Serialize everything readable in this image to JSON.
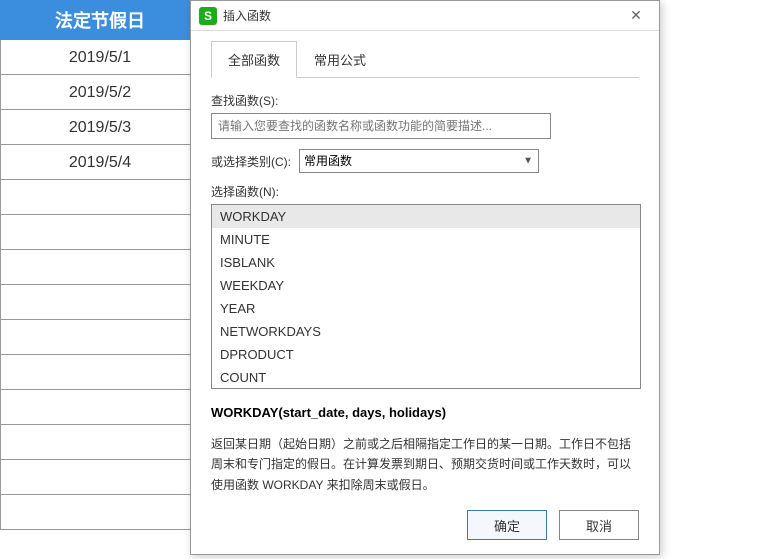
{
  "spreadsheet": {
    "header": "法定节假日",
    "rows": [
      "2019/5/1",
      "2019/5/2",
      "2019/5/3",
      "2019/5/4"
    ]
  },
  "dialog": {
    "title": "插入函数",
    "app_icon_text": "S",
    "tabs": {
      "all": "全部函数",
      "common": "常用公式"
    },
    "search_label": "查找函数(S):",
    "search_placeholder": "请输入您要查找的函数名称或函数功能的简要描述...",
    "category_label": "或选择类别(C):",
    "category_value": "常用函数",
    "select_label": "选择函数(N):",
    "functions": [
      "WORKDAY",
      "MINUTE",
      "ISBLANK",
      "WEEKDAY",
      "YEAR",
      "NETWORKDAYS",
      "DPRODUCT",
      "COUNT"
    ],
    "signature": "WORKDAY(start_date, days, holidays)",
    "description": "返回某日期（起始日期）之前或之后相隔指定工作日的某一日期。工作日不包括周末和专门指定的假日。在计算发票到期日、预期交货时间或工作天数时，可以使用函数 WORKDAY 来扣除周末或假日。",
    "ok": "确定",
    "cancel": "取消"
  }
}
